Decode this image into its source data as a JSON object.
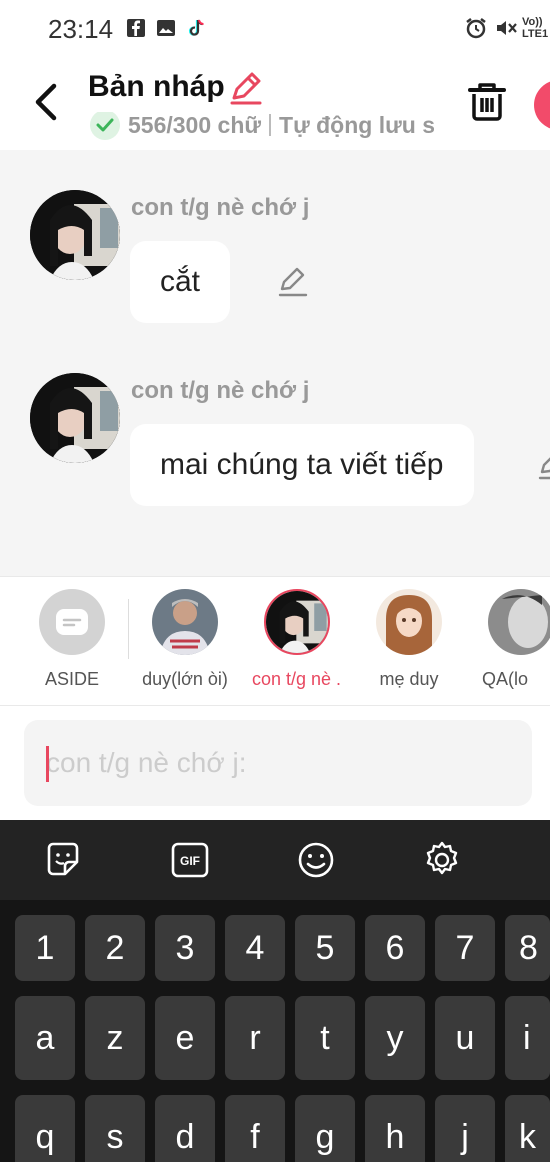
{
  "status_bar": {
    "time": "23:14",
    "network": "Vo)) LTE1"
  },
  "header": {
    "title": "Bản nháp",
    "word_count": "556/300 chữ",
    "autosave": "Tự động lưu s"
  },
  "messages": [
    {
      "sender": "con t/g nè chớ j",
      "text": "cắt"
    },
    {
      "sender": "con t/g nè chớ j",
      "text": "mai chúng ta viết tiếp"
    }
  ],
  "characters": [
    {
      "name": "ASIDE"
    },
    {
      "name": "duy(lớn òi)"
    },
    {
      "name": "con t/g nè ..."
    },
    {
      "name": "mẹ duy"
    },
    {
      "name": "QA(lo"
    }
  ],
  "input": {
    "placeholder": "con t/g nè chớ j:"
  },
  "keyboard": {
    "row_numbers": [
      "1",
      "2",
      "3",
      "4",
      "5",
      "6",
      "7",
      "8"
    ],
    "row_1": [
      "a",
      "z",
      "e",
      "r",
      "t",
      "y",
      "u",
      "i"
    ],
    "row_2": [
      "q",
      "s",
      "d",
      "f",
      "g",
      "h",
      "j",
      "k"
    ]
  },
  "colors": {
    "accent": "#e8475f",
    "success": "#3cb55a",
    "chat_bg": "#f5f5f5",
    "keyboard_bg": "#151515"
  }
}
